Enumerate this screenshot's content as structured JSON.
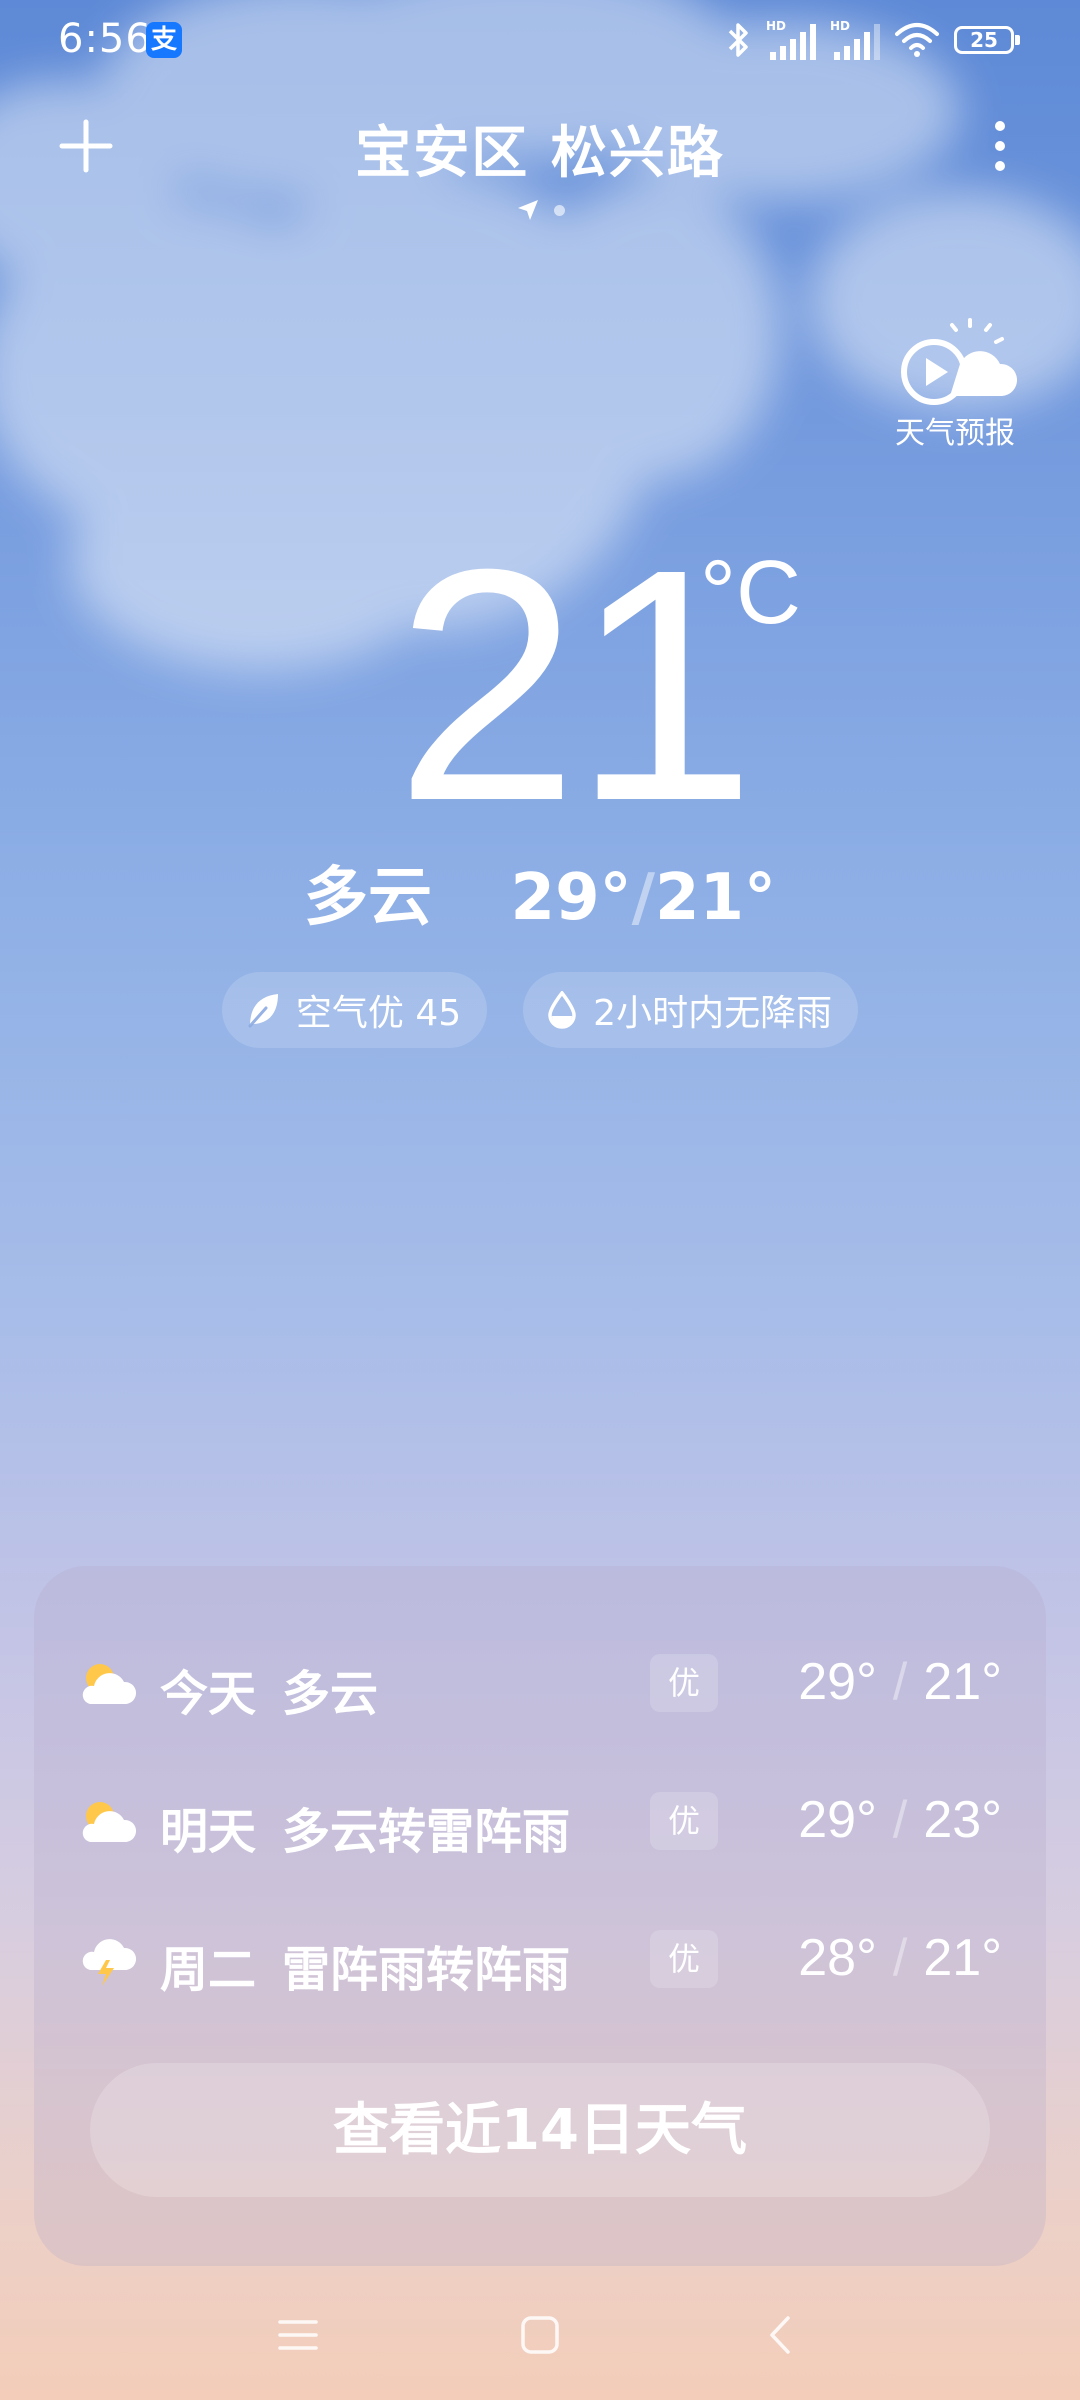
{
  "status_bar": {
    "time": "6:56",
    "alipay_icon_text": "支",
    "battery_level": "25",
    "icons": [
      "bluetooth-icon",
      "signal-hd-1-icon",
      "signal-hd-2-icon",
      "wifi-icon",
      "battery-icon"
    ]
  },
  "header": {
    "location": "宝安区 松兴路",
    "add_icon": "plus-icon",
    "more_icon": "more-vertical-icon"
  },
  "forecast_video": {
    "label": "天气预报",
    "icon": "play-sun-cloud-icon"
  },
  "current": {
    "temperature": "21",
    "unit": "°C",
    "condition": "多云",
    "high": "29°",
    "low": "21°",
    "separator": "/"
  },
  "chips": {
    "air_quality": "空气优 45",
    "rain": "2小时内无降雨"
  },
  "daily": [
    {
      "day": "今天",
      "condition": "多云",
      "aqi": "优",
      "high": "29°",
      "low": "21°",
      "icon": "cloudy-sun-icon"
    },
    {
      "day": "明天",
      "condition": "多云转雷阵雨",
      "aqi": "优",
      "high": "29°",
      "low": "23°",
      "icon": "cloudy-sun-icon"
    },
    {
      "day": "周二",
      "condition": "雷阵雨转阵雨",
      "aqi": "优",
      "high": "28°",
      "low": "21°",
      "icon": "thunder-cloud-icon"
    }
  ],
  "forecast_14_button": "查看近14日天气",
  "colors": {
    "sky_top": "#5d89d6",
    "sky_bottom": "#f3cdb9",
    "text": "#ffffff",
    "sun_yellow": "#ffc84a"
  }
}
